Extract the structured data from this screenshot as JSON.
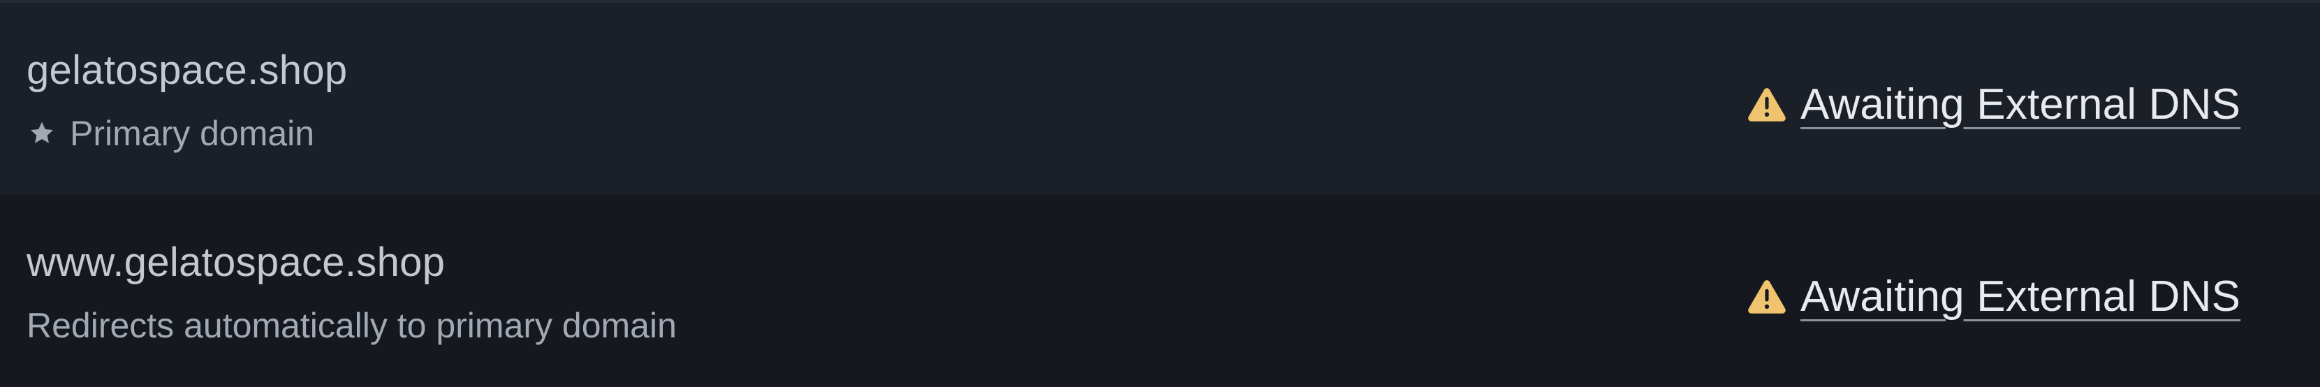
{
  "domains": [
    {
      "name": "gelatospace.shop",
      "subtitle": "Primary domain",
      "subtitle_icon": "star-icon",
      "status": "Awaiting External DNS",
      "status_icon": "warning-icon"
    },
    {
      "name": "www.gelatospace.shop",
      "subtitle": "Redirects automatically to primary domain",
      "status": "Awaiting External DNS",
      "status_icon": "warning-icon"
    }
  ],
  "colors": {
    "row_primary_bg": "#1b1f27",
    "row_secondary_bg": "#15191f",
    "warning": "#f0c46f",
    "link_text": "#e7eaee",
    "muted_text": "#a3a9b3"
  }
}
